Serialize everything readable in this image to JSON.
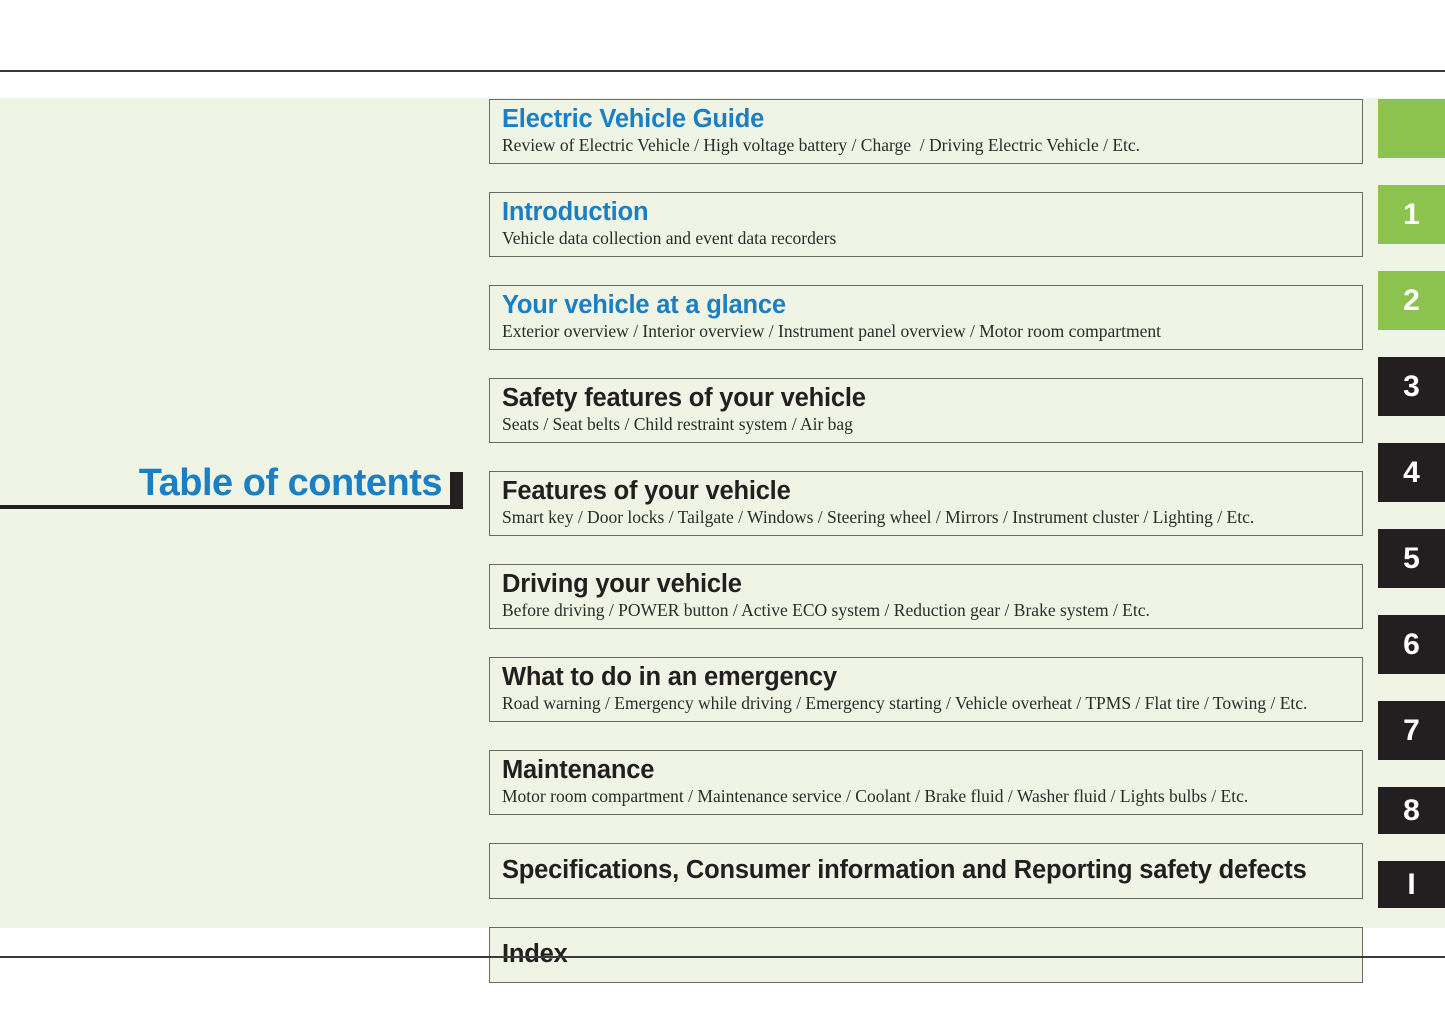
{
  "page": {
    "title": "Table of contents",
    "accent_blue": "#1B7FC4",
    "tab_green": "#8CC34F",
    "tab_dark": "#231F20",
    "panel_background": "#EFF4E5"
  },
  "entries": [
    {
      "heading": "Electric Vehicle Guide",
      "heading_color": "blue",
      "subtitle": "Review of Electric Vehicle / High voltage battery / Charge  / Driving Electric Vehicle / Etc.",
      "tab_label": "",
      "tab_style": "green"
    },
    {
      "heading": "Introduction",
      "heading_color": "blue",
      "subtitle": "Vehicle data collection and event data recorders",
      "tab_label": "1",
      "tab_style": "green"
    },
    {
      "heading": "Your vehicle at a glance",
      "heading_color": "blue",
      "subtitle": "Exterior overview / Interior overview / Instrument panel overview / Motor room compartment",
      "tab_label": "2",
      "tab_style": "green"
    },
    {
      "heading": "Safety features of your vehicle",
      "heading_color": "black",
      "subtitle": "Seats / Seat belts / Child restraint system / Air bag",
      "tab_label": "3",
      "tab_style": "dark"
    },
    {
      "heading": "Features of your vehicle",
      "heading_color": "black",
      "subtitle": "Smart key / Door locks / Tailgate / Windows / Steering wheel / Mirrors / Instrument cluster / Lighting / Etc.",
      "tab_label": "4",
      "tab_style": "dark"
    },
    {
      "heading": "Driving your vehicle",
      "heading_color": "black",
      "subtitle": "Before driving / POWER button / Active ECO system / Reduction gear / Brake system / Etc.",
      "tab_label": "5",
      "tab_style": "dark"
    },
    {
      "heading": "What to do in an emergency",
      "heading_color": "black",
      "subtitle": "Road warning / Emergency while driving / Emergency starting / Vehicle overheat / TPMS / Flat tire / Towing / Etc.",
      "tab_label": "6",
      "tab_style": "dark"
    },
    {
      "heading": "Maintenance",
      "heading_color": "black",
      "subtitle": "Motor room compartment / Maintenance service / Coolant / Brake fluid / Washer fluid / Lights bulbs / Etc.",
      "tab_label": "7",
      "tab_style": "dark"
    },
    {
      "heading": "Specifications, Consumer information and Reporting safety defects",
      "heading_color": "black",
      "subtitle": "",
      "tab_label": "8",
      "tab_style": "dark"
    },
    {
      "heading": "Index",
      "heading_color": "black",
      "subtitle": "",
      "tab_label": "I",
      "tab_style": "dark"
    }
  ]
}
